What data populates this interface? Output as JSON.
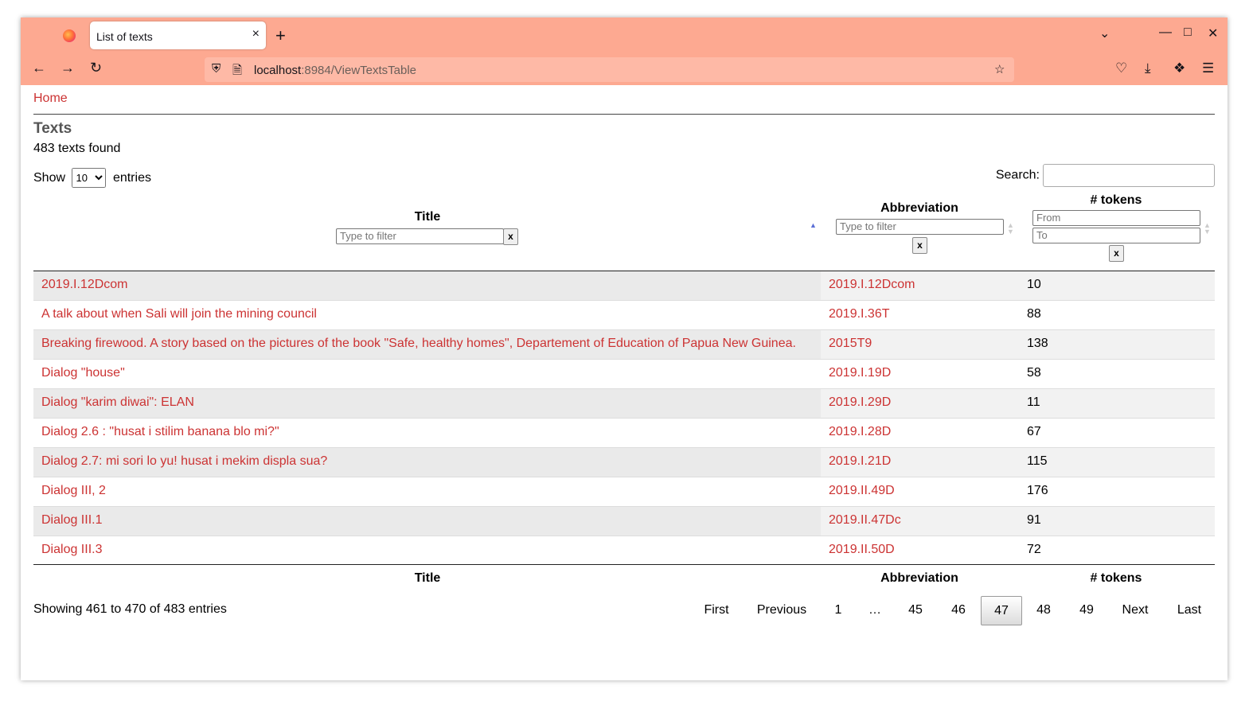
{
  "browser": {
    "tab_title": "List of texts",
    "tab_close": "×",
    "new_tab": "+",
    "url_host": "localhost",
    "url_path": ":8984/ViewTextsTable",
    "icons": [
      "firefox-logo",
      "back-icon",
      "forward-icon",
      "reload-icon",
      "shield-icon",
      "page-icon",
      "star-icon",
      "pocket-icon",
      "download-icon",
      "extensions-icon",
      "menu-icon",
      "minimize-icon",
      "maximize-icon",
      "close-icon"
    ]
  },
  "page": {
    "home_link": "Home",
    "heading": "Texts",
    "found": "483 texts found",
    "show_label": "Show",
    "entries_label": "entries",
    "page_length": "10",
    "search_label": "Search:"
  },
  "table": {
    "headers": {
      "title": "Title",
      "abbreviation": "Abbreviation",
      "tokens": "# tokens"
    },
    "filters": {
      "title_placeholder": "Type to filter",
      "abbr_placeholder": "Type to filter",
      "from_placeholder": "From",
      "to_placeholder": "To",
      "clear": "x"
    },
    "rows": [
      {
        "title": "2019.I.12Dcom",
        "abbr": "2019.I.12Dcom",
        "tokens": "10"
      },
      {
        "title": "A talk about when Sali will join the mining council",
        "abbr": "2019.I.36T",
        "tokens": "88"
      },
      {
        "title": "Breaking firewood. A story based on the pictures of the book \"Safe, healthy homes\", Departement of Education of Papua New Guinea.",
        "abbr": "2015T9",
        "tokens": "138"
      },
      {
        "title": "Dialog \"house\"",
        "abbr": "2019.I.19D",
        "tokens": "58"
      },
      {
        "title": "Dialog \"karim diwai\": ELAN",
        "abbr": "2019.I.29D",
        "tokens": "11"
      },
      {
        "title": "Dialog 2.6 : \"husat i stilim banana blo mi?\"",
        "abbr": "2019.I.28D",
        "tokens": "67"
      },
      {
        "title": "Dialog 2.7: mi sori lo yu! husat i mekim displa sua?",
        "abbr": "2019.I.21D",
        "tokens": "115"
      },
      {
        "title": "Dialog III, 2",
        "abbr": "2019.II.49D",
        "tokens": "176"
      },
      {
        "title": "Dialog III.1",
        "abbr": "2019.II.47Dc",
        "tokens": "91"
      },
      {
        "title": "Dialog III.3",
        "abbr": "2019.II.50D",
        "tokens": "72"
      }
    ]
  },
  "footer": {
    "info": "Showing 461 to 470 of 483 entries",
    "pagination": {
      "first": "First",
      "previous": "Previous",
      "p1": "1",
      "ellipsis": "…",
      "p45": "45",
      "p46": "46",
      "p47": "47",
      "p48": "48",
      "p49": "49",
      "next": "Next",
      "last": "Last"
    }
  }
}
